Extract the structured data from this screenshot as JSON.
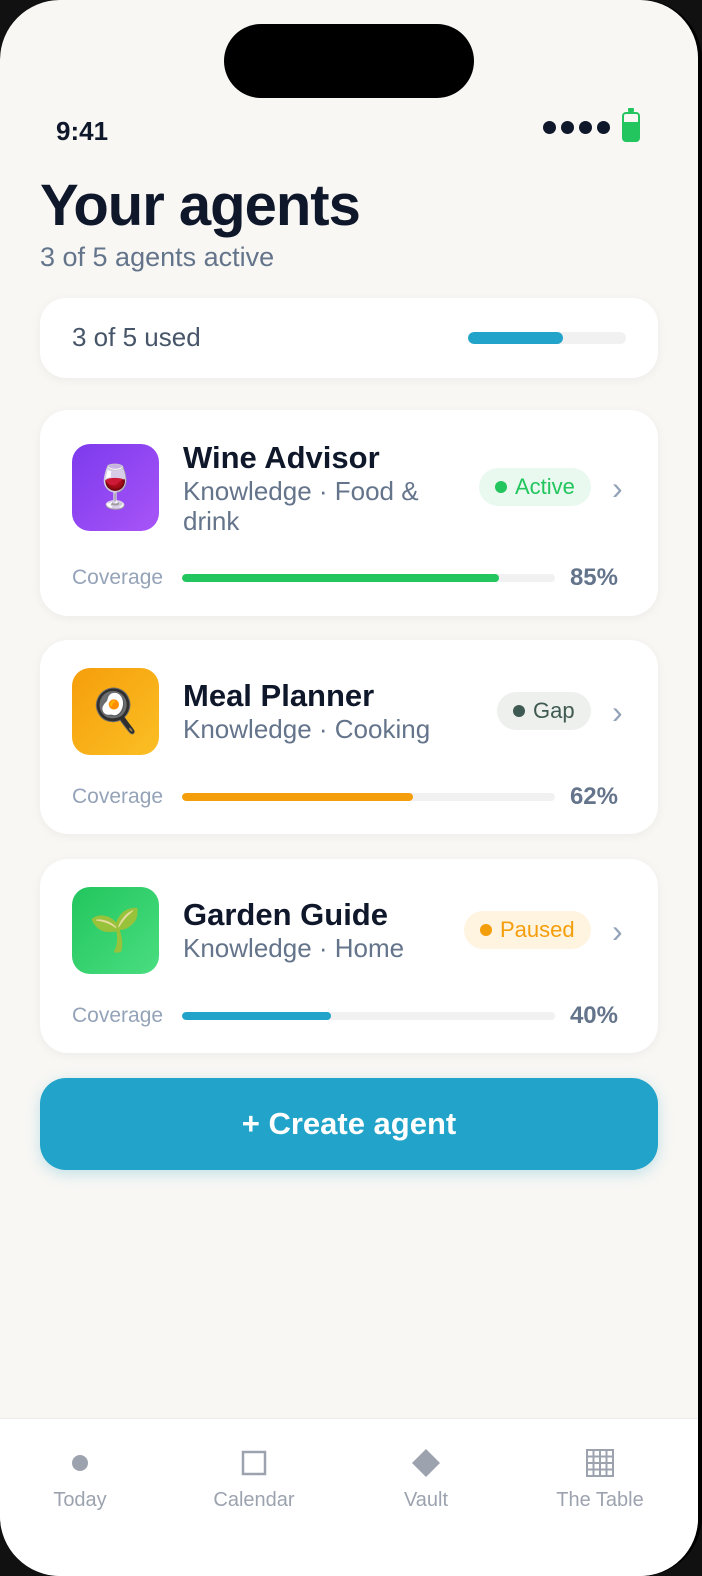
{
  "status": {
    "time": "9:41"
  },
  "header": {
    "title": "Your agents",
    "subtitle": "3 of 5 agents active"
  },
  "usage": {
    "label": "3 of 5 used",
    "used": 3,
    "total": 5
  },
  "agents": [
    {
      "name": "Wine Advisor",
      "meta": "Knowledge · Food & drink",
      "icon": "wine-glass-icon",
      "icon_glyph": "🍷",
      "status": "Active",
      "coverage_label": "Coverage",
      "coverage_text": "85%",
      "coverage": 85,
      "color": "#22c55e"
    },
    {
      "name": "Meal Planner",
      "meta": "Knowledge · Cooking",
      "icon": "frying-pan-egg-icon",
      "icon_glyph": "🍳",
      "status": "Gap",
      "coverage_label": "Coverage",
      "coverage_text": "62%",
      "coverage": 62,
      "color": "#f59e0b"
    },
    {
      "name": "Garden Guide",
      "meta": "Knowledge · Home",
      "icon": "seedling-icon",
      "icon_glyph": "🌱",
      "status": "Paused",
      "coverage_label": "Coverage",
      "coverage_text": "40%",
      "coverage": 40,
      "color": "#22a3c9"
    }
  ],
  "create_button": {
    "label": "+ Create agent"
  },
  "tabs": [
    {
      "label": "Today",
      "icon": "circle-icon"
    },
    {
      "label": "Calendar",
      "icon": "square-icon"
    },
    {
      "label": "Vault",
      "icon": "diamond-icon"
    },
    {
      "label": "The Table",
      "icon": "grid-icon"
    }
  ],
  "colors": {
    "accent": "#22a3c9",
    "active_badge_bg": "#e9f9ef",
    "active_badge_fg": "#22c55e",
    "gap_badge_bg": "#eef0ee",
    "gap_badge_fg": "#3f5a52",
    "paused_badge_bg": "#fff4e0",
    "paused_badge_fg": "#f59e0b"
  }
}
